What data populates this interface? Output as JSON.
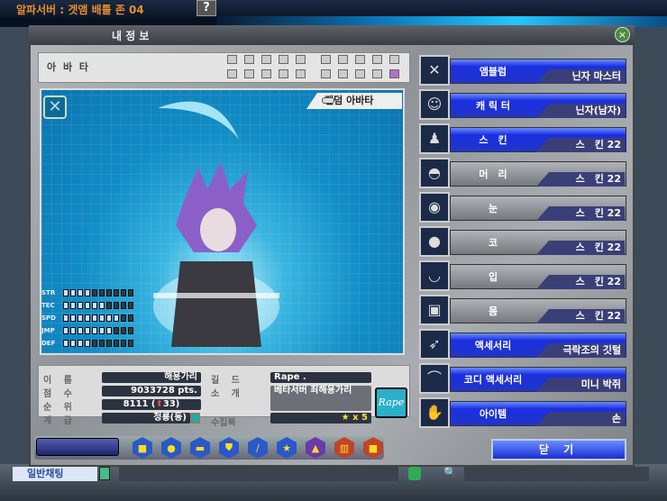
{
  "window": {
    "server_title": "알파서버 : 겟앰 배틀 존 04",
    "help_label": "?"
  },
  "dialog": {
    "title": "내 정 보",
    "close_icon": "×"
  },
  "avatar": {
    "label": "아 바 타",
    "random_avatar_label": "랜덤 아바타",
    "slots_filled": 1,
    "slots_total": 20
  },
  "stats": [
    {
      "name": "STR",
      "level": 4,
      "max": 10
    },
    {
      "name": "TEC",
      "level": 6,
      "max": 10
    },
    {
      "name": "SPD",
      "level": 8,
      "max": 10
    },
    {
      "name": "JMP",
      "level": 7,
      "max": 10
    },
    {
      "name": "DEF",
      "level": 4,
      "max": 10
    }
  ],
  "profile": {
    "name_label": "이 름",
    "name": "해용가리",
    "score_label": "점 수",
    "score": "9033728 pts.",
    "rank_label": "순 위",
    "rank": "8111 (",
    "rank_change": "33)",
    "grade_label": "계 급",
    "grade": "청룡(동)",
    "guild_label": "길 드",
    "guild": "Rape .",
    "intro_label": "소 개",
    "intro": "베타서버 최해용가리",
    "collection_label": "수집북",
    "collection": "★ x 5",
    "guild_logo_text": "Rape"
  },
  "equipment": [
    {
      "label": "앰블럼",
      "value": "닌자 마스터",
      "style": "blue",
      "icon": "emblem-icon",
      "glyph": "✕"
    },
    {
      "label": "캐 릭 터",
      "value": "닌자(남자)",
      "style": "blue",
      "icon": "character-icon",
      "glyph": "☺"
    },
    {
      "label": "스　킨",
      "value": "스　킨 22",
      "style": "blue",
      "icon": "skin-icon",
      "glyph": "♟"
    },
    {
      "label": "머　리",
      "value": "스　킨 22",
      "style": "gray",
      "icon": "hair-icon",
      "glyph": "◓"
    },
    {
      "label": "눈",
      "value": "스　킨 22",
      "style": "gray",
      "icon": "eyes-icon",
      "glyph": "◉"
    },
    {
      "label": "코",
      "value": "스　킨 22",
      "style": "gray",
      "icon": "nose-icon",
      "glyph": "●"
    },
    {
      "label": "입",
      "value": "스　킨 22",
      "style": "gray",
      "icon": "mouth-icon",
      "glyph": "◡"
    },
    {
      "label": "몸",
      "value": "스　킨 22",
      "style": "gray",
      "icon": "body-icon",
      "glyph": "▣"
    },
    {
      "label": "액세서리",
      "value": "극락조의 깃털",
      "style": "blue",
      "icon": "feather-icon",
      "glyph": "➶"
    },
    {
      "label": "코디 액세서리",
      "value": "미니 박쥐",
      "style": "blue",
      "icon": "bat-icon",
      "glyph": "⌒"
    },
    {
      "label": "아이템",
      "value": "손",
      "style": "blue",
      "icon": "hand-icon",
      "glyph": "✋"
    }
  ],
  "close_button": "닫 기",
  "chat": {
    "mode": "일반채팅"
  }
}
